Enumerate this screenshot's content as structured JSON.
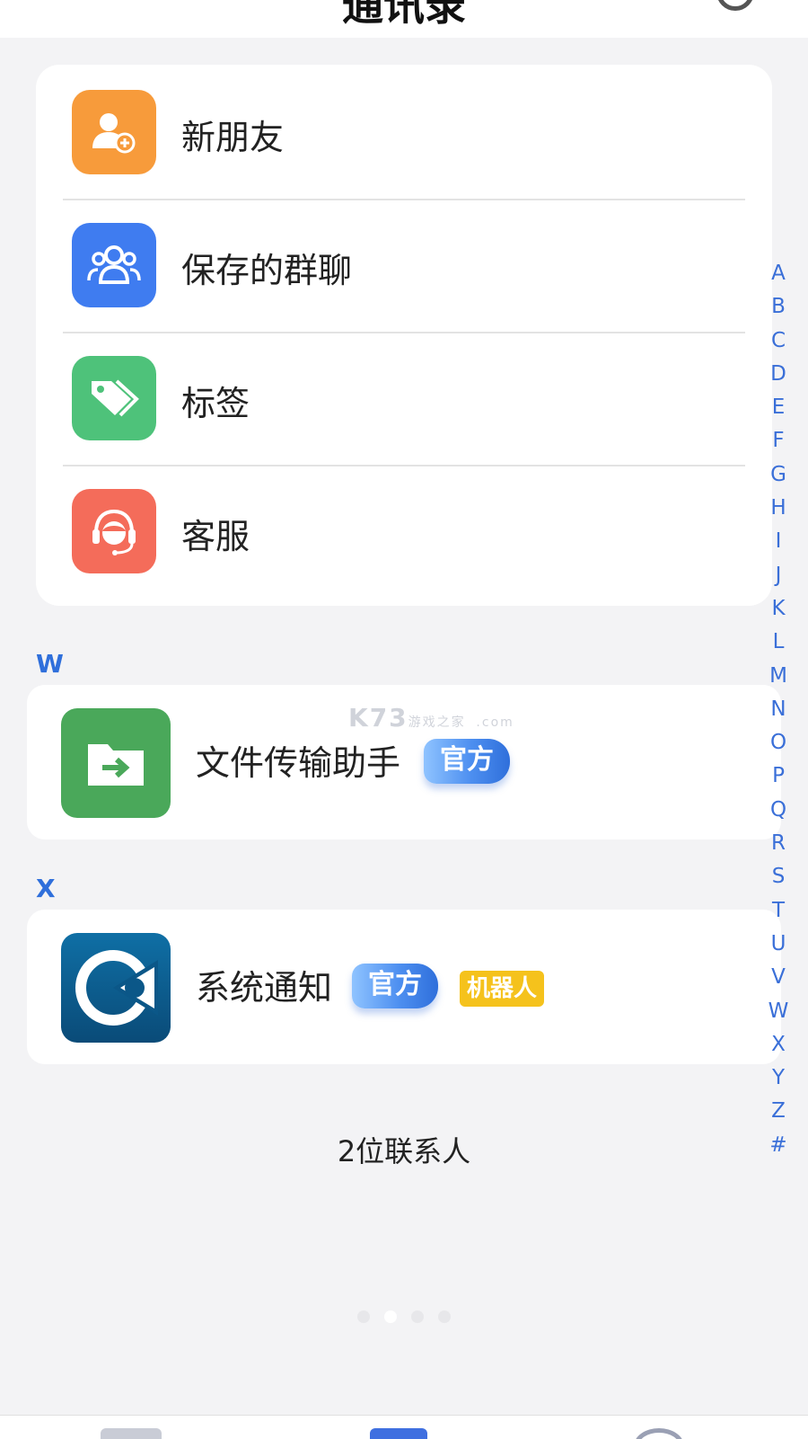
{
  "header": {
    "title": "通讯录"
  },
  "menu": [
    {
      "label": "新朋友",
      "color": "#f79b3b",
      "icon": "add-friend-icon"
    },
    {
      "label": "保存的群聊",
      "color": "#3f7cf0",
      "icon": "group-icon"
    },
    {
      "label": "标签",
      "color": "#4ec27a",
      "icon": "tag-icon"
    },
    {
      "label": "客服",
      "color": "#f46c5a",
      "icon": "customer-service-icon"
    }
  ],
  "sections": [
    {
      "letter": "W",
      "contact": {
        "name": "文件传输助手",
        "badge": "官方",
        "avatar_color": "#4aa85a",
        "icon": "file-transfer-icon"
      }
    },
    {
      "letter": "X",
      "contact": {
        "name": "系统通知",
        "badge": "官方",
        "badge2": "机器人",
        "avatar_color": "#0a4b78",
        "icon": "system-logo-icon"
      }
    }
  ],
  "contact_count": "2位联系人",
  "alphabet": [
    "A",
    "B",
    "C",
    "D",
    "E",
    "F",
    "G",
    "H",
    "I",
    "J",
    "K",
    "L",
    "M",
    "N",
    "O",
    "P",
    "Q",
    "R",
    "S",
    "T",
    "U",
    "V",
    "W",
    "X",
    "Y",
    "Z",
    "#"
  ],
  "watermark": {
    "brand": "K73",
    "tagline": "游戏之家",
    "domain": ".com"
  },
  "pager": {
    "count": 4,
    "active_index": 1
  }
}
